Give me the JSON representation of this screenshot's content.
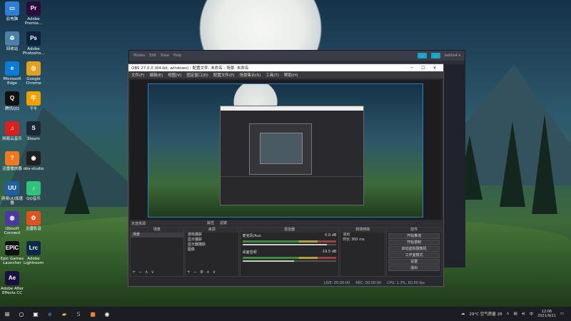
{
  "desktop_icons": [
    {
      "label": "此电脑",
      "icon": "computer-icon",
      "color": "#2d7fd3",
      "glyph": "▭"
    },
    {
      "label": "Adobe Premie...",
      "icon": "premiere-icon",
      "color": "#2a0d3c",
      "glyph": "Pr"
    },
    {
      "label": "回收站",
      "icon": "recycle-bin-icon",
      "color": "#4a7fa8",
      "glyph": "♻"
    },
    {
      "label": "Adobe Photosho...",
      "icon": "photoshop-icon",
      "color": "#0a2440",
      "glyph": "Ps"
    },
    {
      "label": "Microsoft Edge",
      "icon": "edge-icon",
      "color": "#0b7bd3",
      "glyph": "e"
    },
    {
      "label": "Google Chrome",
      "icon": "chrome-icon",
      "color": "#e0a020",
      "glyph": "◎"
    },
    {
      "label": "腾讯QQ",
      "icon": "qq-icon",
      "color": "#111111",
      "glyph": "Q"
    },
    {
      "label": "千牛",
      "icon": "qianniu-icon",
      "color": "#f0a000",
      "glyph": "牛"
    },
    {
      "label": "网易云音乐",
      "icon": "netease-music-icon",
      "color": "#d8201c",
      "glyph": "♫"
    },
    {
      "label": "Steam",
      "icon": "steam-icon",
      "color": "#1b2838",
      "glyph": "S"
    },
    {
      "label": "迅雷播放器",
      "icon": "thunder-player-icon",
      "color": "#f07820",
      "glyph": "?"
    },
    {
      "label": "obs-studio",
      "icon": "obs-icon",
      "color": "#202020",
      "glyph": "◉"
    },
    {
      "label": "网易UU加速器",
      "icon": "uu-accelerator-icon",
      "color": "#1f5fa0",
      "glyph": "UU"
    },
    {
      "label": "QQ音乐",
      "icon": "qq-music-icon",
      "color": "#31c27c",
      "glyph": "♪"
    },
    {
      "label": "Ubisoft Connect",
      "icon": "ubisoft-icon",
      "color": "#4a3aa0",
      "glyph": "◍"
    },
    {
      "label": "迅雷影音",
      "icon": "xunlei-icon",
      "color": "#e05020",
      "glyph": "✿"
    },
    {
      "label": "Epic Games Launcher",
      "icon": "epic-icon",
      "color": "#111111",
      "glyph": "EPIC"
    },
    {
      "label": "Adobe Lightroom",
      "icon": "lightroom-icon",
      "color": "#0c2a46",
      "glyph": "Lrc"
    },
    {
      "label": "Adobe After Effects CC",
      "icon": "after-effects-icon",
      "color": "#1a0f3d",
      "glyph": "Ae"
    }
  ],
  "obs_back": {
    "menu": [
      "Modes",
      "Edit",
      "View",
      "Help"
    ],
    "btn1": "...",
    "btn2": "...",
    "account": "bekko4 ▾"
  },
  "obs": {
    "title": "OBS 27.0.0 (64-bit, windows) - 配置文件: 未命名 - 场景: 未命名",
    "menu": [
      "文件(F)",
      "编辑(E)",
      "视图(V)",
      "固定窗口(D)",
      "配置文件(P)",
      "场景集合(S)",
      "工具(T)",
      "帮助(H)"
    ],
    "no_source": "无选择源",
    "props_label": "属性",
    "filters_label": "滤镜",
    "docks": {
      "scenes": {
        "title": "场景",
        "items": [
          "场景"
        ]
      },
      "sources": {
        "title": "来源",
        "items": [
          "游戏捕获",
          "显示捕获",
          "显示器捕获",
          "图像"
        ]
      },
      "mixer": {
        "title": "混音器",
        "tracks": [
          {
            "name": "麦克风/Aux",
            "db": "0.0 dB",
            "level": 0.9
          },
          {
            "name": "桌面音频",
            "db": "-19.5 dB",
            "level": 0.55
          }
        ]
      },
      "transitions": {
        "title": "转场特效",
        "type": "淡出",
        "duration_label": "时长",
        "duration": "300 ms"
      },
      "controls": {
        "title": "控件",
        "buttons": [
          "开始推流",
          "开始录制",
          "启动虚拟摄像机",
          "工作室模式",
          "设置",
          "退出"
        ]
      }
    },
    "status": {
      "live": "LIVE: 00:00:00",
      "rec": "REC: 00:00:00",
      "cpu": "CPU: 1.3%, 60.00 fps"
    }
  },
  "taskbar": {
    "weather": "29°C 空气质量 28",
    "time": "12:06",
    "date": "2021/9/21"
  }
}
